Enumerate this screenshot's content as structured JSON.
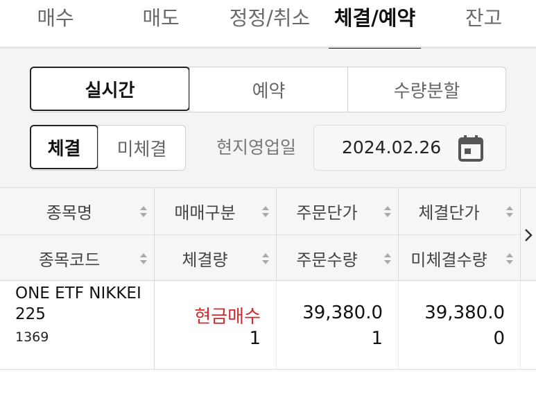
{
  "tabs": [
    {
      "label": "매수"
    },
    {
      "label": "매도"
    },
    {
      "label": "정정/취소"
    },
    {
      "label": "체결/예약",
      "active": true
    },
    {
      "label": "잔고"
    }
  ],
  "mode_segment": {
    "items": [
      "실시간",
      "예약",
      "수량분할"
    ],
    "selected": "실시간"
  },
  "fill_segment": {
    "items": [
      "체결",
      "미체결"
    ],
    "selected": "체결"
  },
  "business_day": {
    "label": "현지영업일",
    "value": "2024.02.26",
    "icon": "calendar-icon"
  },
  "table": {
    "header_row1": [
      "종목명",
      "매매구분",
      "주문단가",
      "체결단가"
    ],
    "header_row2": [
      "종목코드",
      "체결량",
      "주문수량",
      "미체결수량"
    ],
    "rows": [
      {
        "name": "ONE ETF NIKKEI 225",
        "code": "1369",
        "trade_type": "현금매수",
        "filled_qty": "1",
        "order_price": "39,380.0",
        "order_qty": "1",
        "fill_price": "39,380.0",
        "unfilled_qty": "0"
      }
    ]
  },
  "colors": {
    "accent_active": "#111111",
    "buy_red": "#d4282d",
    "panel_bg": "#f4f4f4"
  }
}
